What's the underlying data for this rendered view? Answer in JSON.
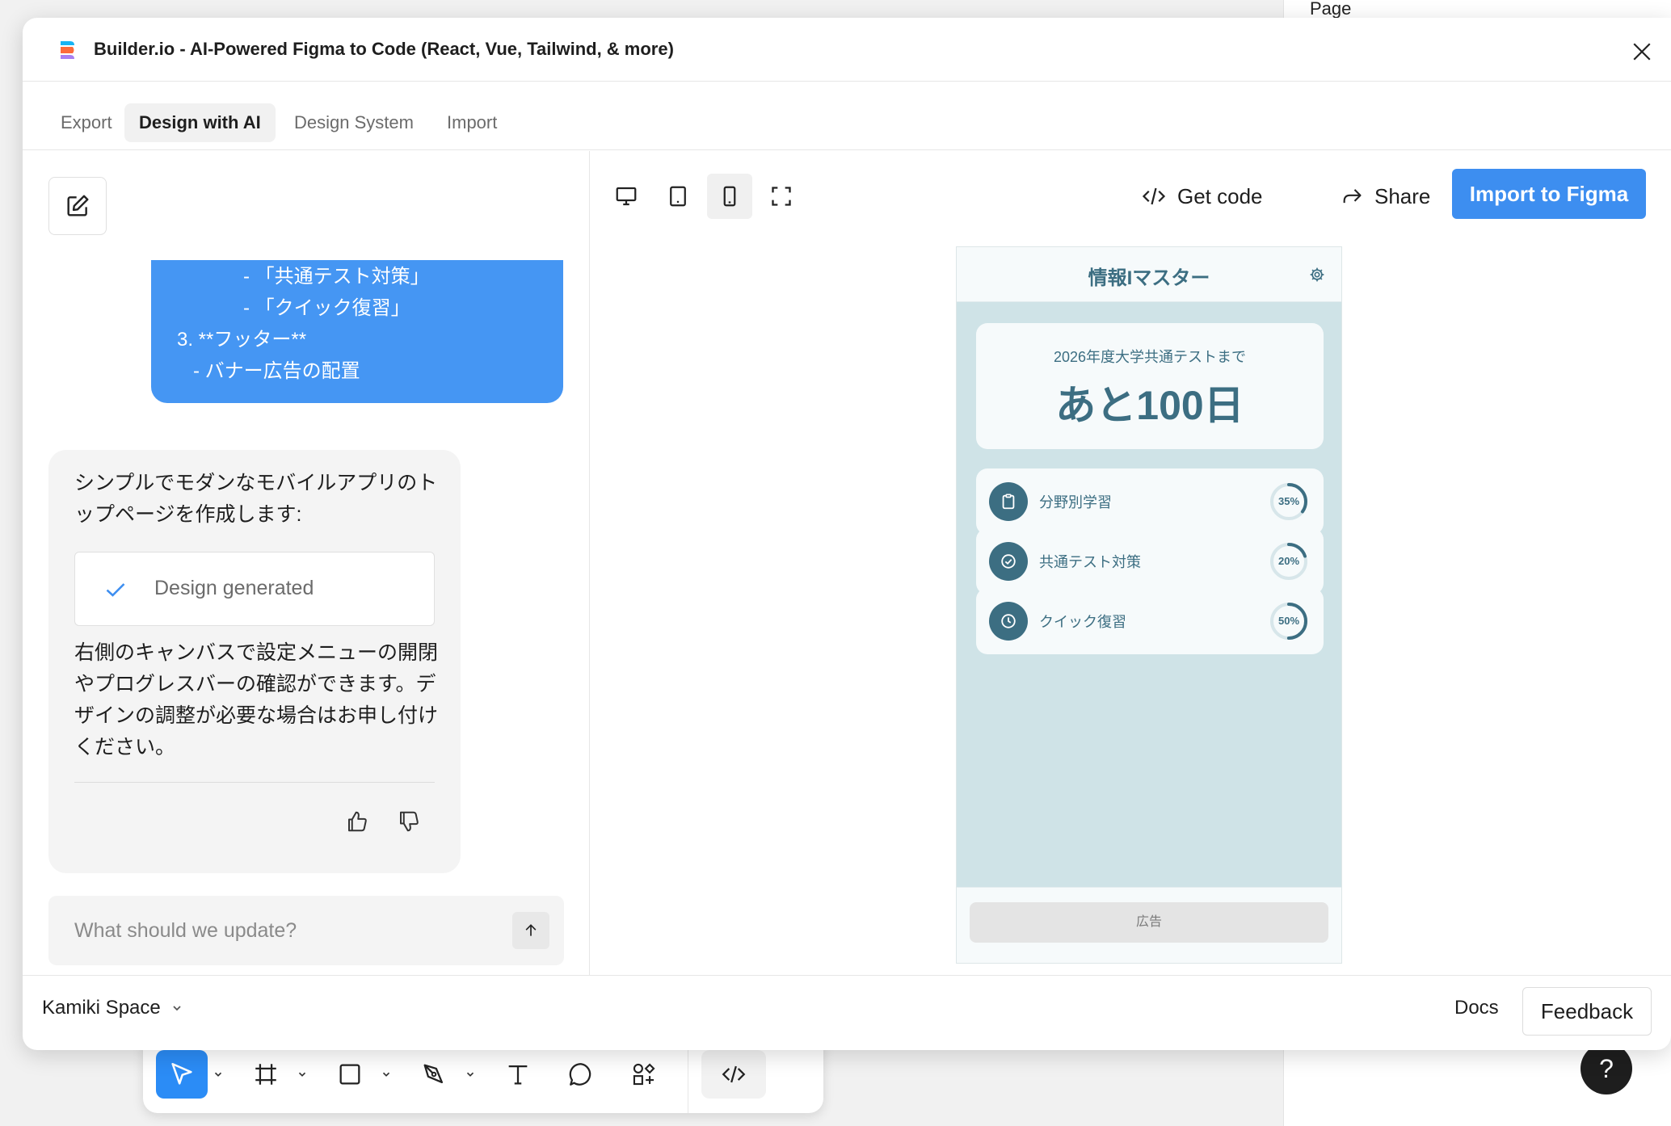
{
  "figma": {
    "side_panel_title": "Page",
    "help_label": "?",
    "toolbar": {
      "tools": [
        "move-tool",
        "frame-tool",
        "rectangle-tool",
        "pen-tool",
        "text-tool",
        "comment-tool",
        "components-tool",
        "dev-mode-toggle"
      ],
      "active_tool": "move-tool"
    }
  },
  "plugin": {
    "title": "Builder.io - AI-Powered Figma to Code (React, Vue, Tailwind, & more)",
    "tabs": [
      {
        "label": "Export",
        "active": false
      },
      {
        "label": "Design with AI",
        "active": true
      },
      {
        "label": "Design System",
        "active": false
      },
      {
        "label": "Import",
        "active": false
      }
    ],
    "chat": {
      "user_message_lines": [
        "-  「共通テスト対策」",
        "-  「クイック復習」",
        "3. **フッター**",
        "- バナー広告の配置"
      ],
      "ai_intro": "シンプルでモダンなモバイルアプリのトップページを作成します:",
      "design_status": "Design generated",
      "ai_outro": "右側のキャンバスで設定メニューの開閉やプログレスバーの確認ができます。デザインの調整が必要な場合はお申し付けください。",
      "prompt_placeholder": "What should we update?",
      "prompt_value": ""
    },
    "preview": {
      "devices": [
        "desktop",
        "tablet",
        "mobile",
        "fullscreen"
      ],
      "active_device": "mobile",
      "get_code_label": "Get code",
      "share_label": "Share",
      "import_label": "Import to Figma"
    },
    "phone": {
      "title": "情報Iマスター",
      "countdown_label": "2026年度大学共通テストまで",
      "countdown_value": "あと100日",
      "subjects": [
        {
          "label": "分野別学習",
          "icon": "clipboard-icon",
          "progress": 35,
          "progress_label": "35%"
        },
        {
          "label": "共通テスト対策",
          "icon": "check-circle-icon",
          "progress": 20,
          "progress_label": "20%"
        },
        {
          "label": "クイック復習",
          "icon": "clock-icon",
          "progress": 50,
          "progress_label": "50%"
        }
      ],
      "ad_label": "広告",
      "colors": {
        "primary": "#3c6e82",
        "background": "#cfe3e7",
        "card": "#f6fafb",
        "ring_track": "#d7e6ea"
      }
    },
    "footer": {
      "workspace": "Kamiki Space",
      "docs_label": "Docs",
      "feedback_label": "Feedback"
    },
    "colors": {
      "accent": "#3d8ef0",
      "user_bubble": "#4596f3"
    }
  }
}
